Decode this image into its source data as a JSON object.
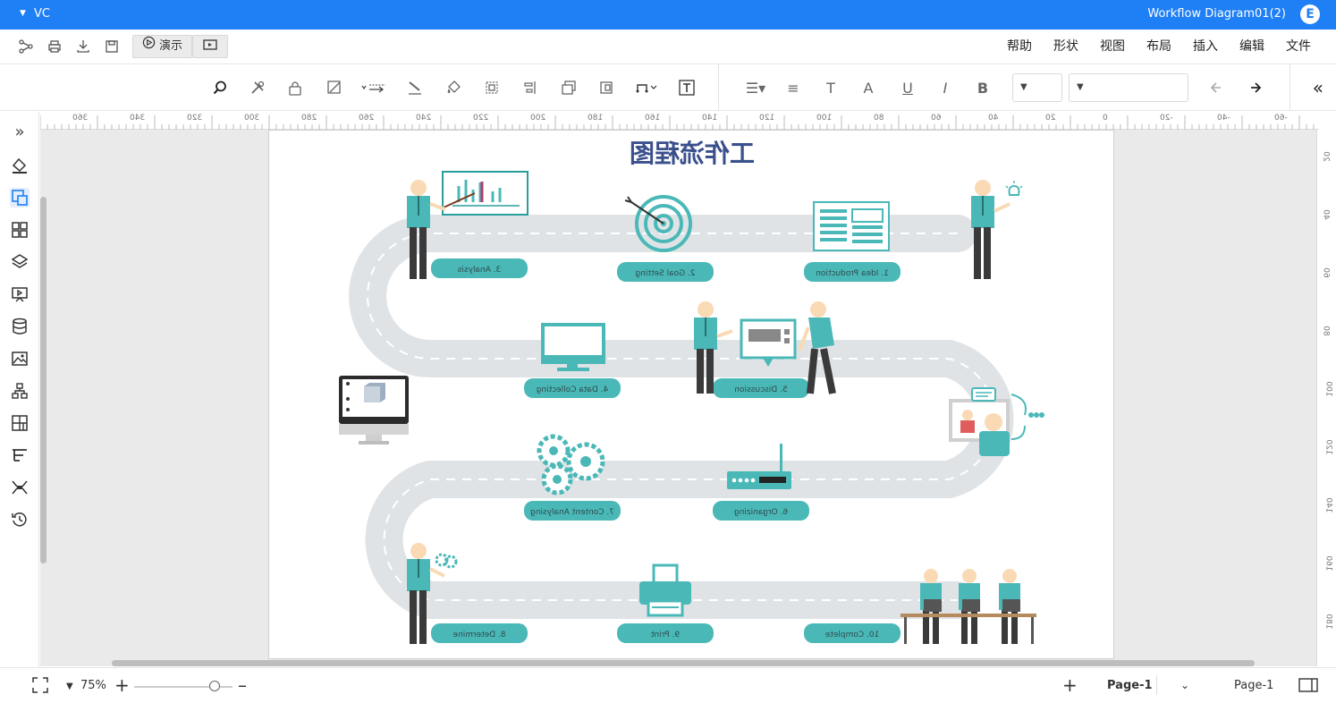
{
  "titlebar": {
    "app_logo": "E",
    "doc_title": "Workflow Diagram01(2)",
    "user": "VC"
  },
  "menu": [
    "文件",
    "编辑",
    "插入",
    "布局",
    "视图",
    "形状",
    "帮助"
  ],
  "menubar_tools": {
    "present_label": "演示"
  },
  "diagram": {
    "title": "工作流程图",
    "steps": [
      "1. Idea Production",
      "2. Goal Setting",
      "3. Analysis",
      "4. Data Collecting",
      "5. Discussion",
      "6. Organizing",
      "7. Content Analysing",
      "8. Determine",
      "9. Print",
      "10. Complete"
    ]
  },
  "ruler_h": [
    "-60",
    "-40",
    "-20",
    "0",
    "20",
    "40",
    "60",
    "80",
    "100",
    "120",
    "140",
    "160",
    "180",
    "200",
    "220",
    "240",
    "260",
    "280",
    "300",
    "320",
    "340",
    "360"
  ],
  "ruler_v": [
    "20",
    "40",
    "60",
    "80",
    "100",
    "120",
    "140",
    "160",
    "180"
  ],
  "status": {
    "page_selector": "Page-1",
    "active_tab": "Page-1",
    "zoom": "75%"
  },
  "colors": {
    "accent": "#1f7ff5",
    "teal": "#4bb8b8",
    "road": "#dfe3e6",
    "title": "#3a4f8c"
  }
}
